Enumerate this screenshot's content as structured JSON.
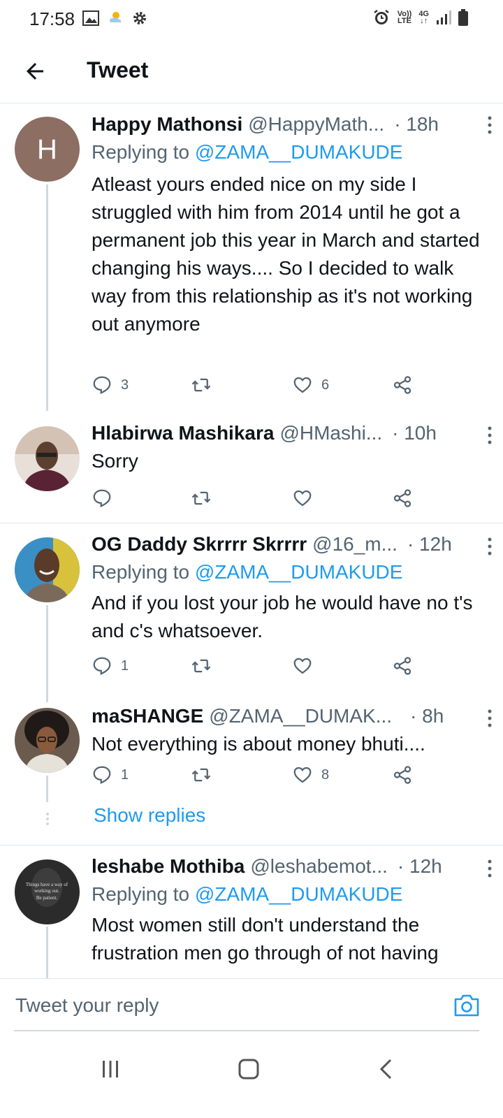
{
  "status": {
    "time": "17:58",
    "network_volte": "Vo))",
    "network_lte": "LTE",
    "network_type": "4G"
  },
  "header": {
    "title": "Tweet"
  },
  "tweets": [
    {
      "name": "Happy Mathonsi",
      "handle": "@HappyMath...",
      "time": "· 18h",
      "replying_prefix": "Replying to ",
      "replying_to": "@ZAMA__DUMAKUDE",
      "text": "Atleast yours ended nice on my side I struggled with him from 2014 until he got a permanent job this year in March and started changing his ways.... So I decided to walk way from this relationship as it's not working out anymore",
      "replies": "3",
      "retweets": "",
      "likes": "6",
      "avatar_letter": "H",
      "avatar_color": "#8d6e63"
    },
    {
      "name": "Hlabirwa Mashikara",
      "handle": "@HMashi...",
      "time": "· 10h",
      "text": "Sorry",
      "replies": "",
      "retweets": "",
      "likes": ""
    },
    {
      "name": "OG Daddy Skrrrr Skrrrr",
      "handle": "@16_m...",
      "time": "· 12h",
      "replying_prefix": "Replying to ",
      "replying_to": "@ZAMA__DUMAKUDE",
      "text": "And if you lost your job he would have no t's and c's whatsoever.",
      "replies": "1",
      "retweets": "",
      "likes": ""
    },
    {
      "name": "maSHANGE",
      "handle": "@ZAMA__DUMAK...",
      "time": "· 8h",
      "text": "Not everything is about money bhuti....",
      "replies": "1",
      "retweets": "",
      "likes": "8"
    },
    {
      "name": "leshabe Mothiba",
      "handle": "@leshabemot...",
      "time": "· 12h",
      "replying_prefix": "Replying to ",
      "replying_to": "@ZAMA__DUMAKUDE",
      "text": "Most women still don't understand the frustration men go through of not having",
      "avatar_text_1": "Things have a way of",
      "avatar_text_2": "working out.",
      "avatar_text_3": "Be patient."
    }
  ],
  "show_replies": "Show replies",
  "composer": {
    "placeholder": "Tweet your reply"
  },
  "colors": {
    "accent": "#1d9bf0",
    "secondary_text": "#536471",
    "primary_text": "#0f1419"
  },
  "icons": [
    "back-arrow-icon",
    "reply-icon",
    "retweet-icon",
    "like-icon",
    "share-icon",
    "more-icon",
    "camera-icon"
  ]
}
